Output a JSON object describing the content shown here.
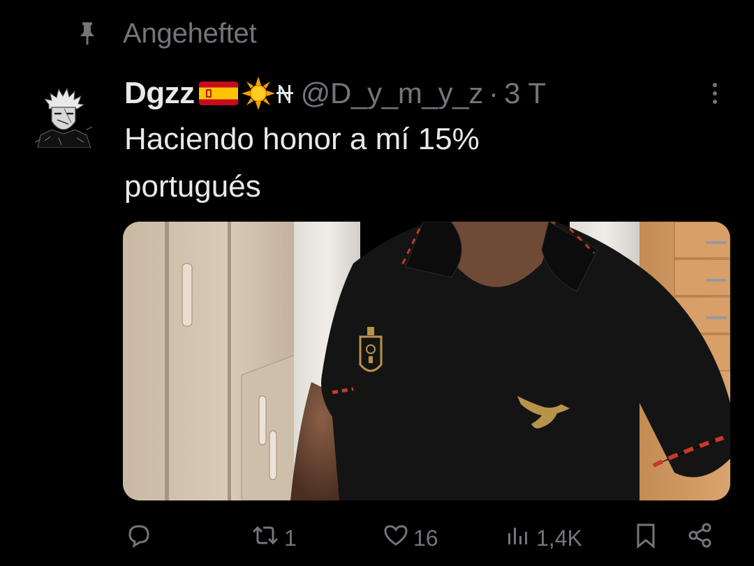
{
  "pinned": {
    "label": "Angeheftet",
    "icon": "pin-icon"
  },
  "author": {
    "display_name": "Dgzz",
    "emojis": [
      "flag-spain-emoji",
      "sun-emoji",
      "sign-emoji"
    ],
    "handle": "@D_y_m_y_z",
    "separator": "·",
    "time": "3 T",
    "avatar_icon": "avatar"
  },
  "tweet": {
    "text_line1": "Haciendo honor a mí 15%",
    "text_line2": "portugués"
  },
  "actions": {
    "reply": {
      "icon": "reply-icon",
      "count": ""
    },
    "retweet": {
      "icon": "retweet-icon",
      "count": "1"
    },
    "like": {
      "icon": "heart-icon",
      "count": "16"
    },
    "views": {
      "icon": "views-icon",
      "count": "1,4K"
    },
    "bookmark": {
      "icon": "bookmark-icon"
    },
    "share": {
      "icon": "share-icon"
    }
  },
  "colors": {
    "background": "#000000",
    "text_primary": "#e7e9ea",
    "text_secondary": "#71767b",
    "jersey": "#111111",
    "crest_gold": "#b8934a"
  }
}
